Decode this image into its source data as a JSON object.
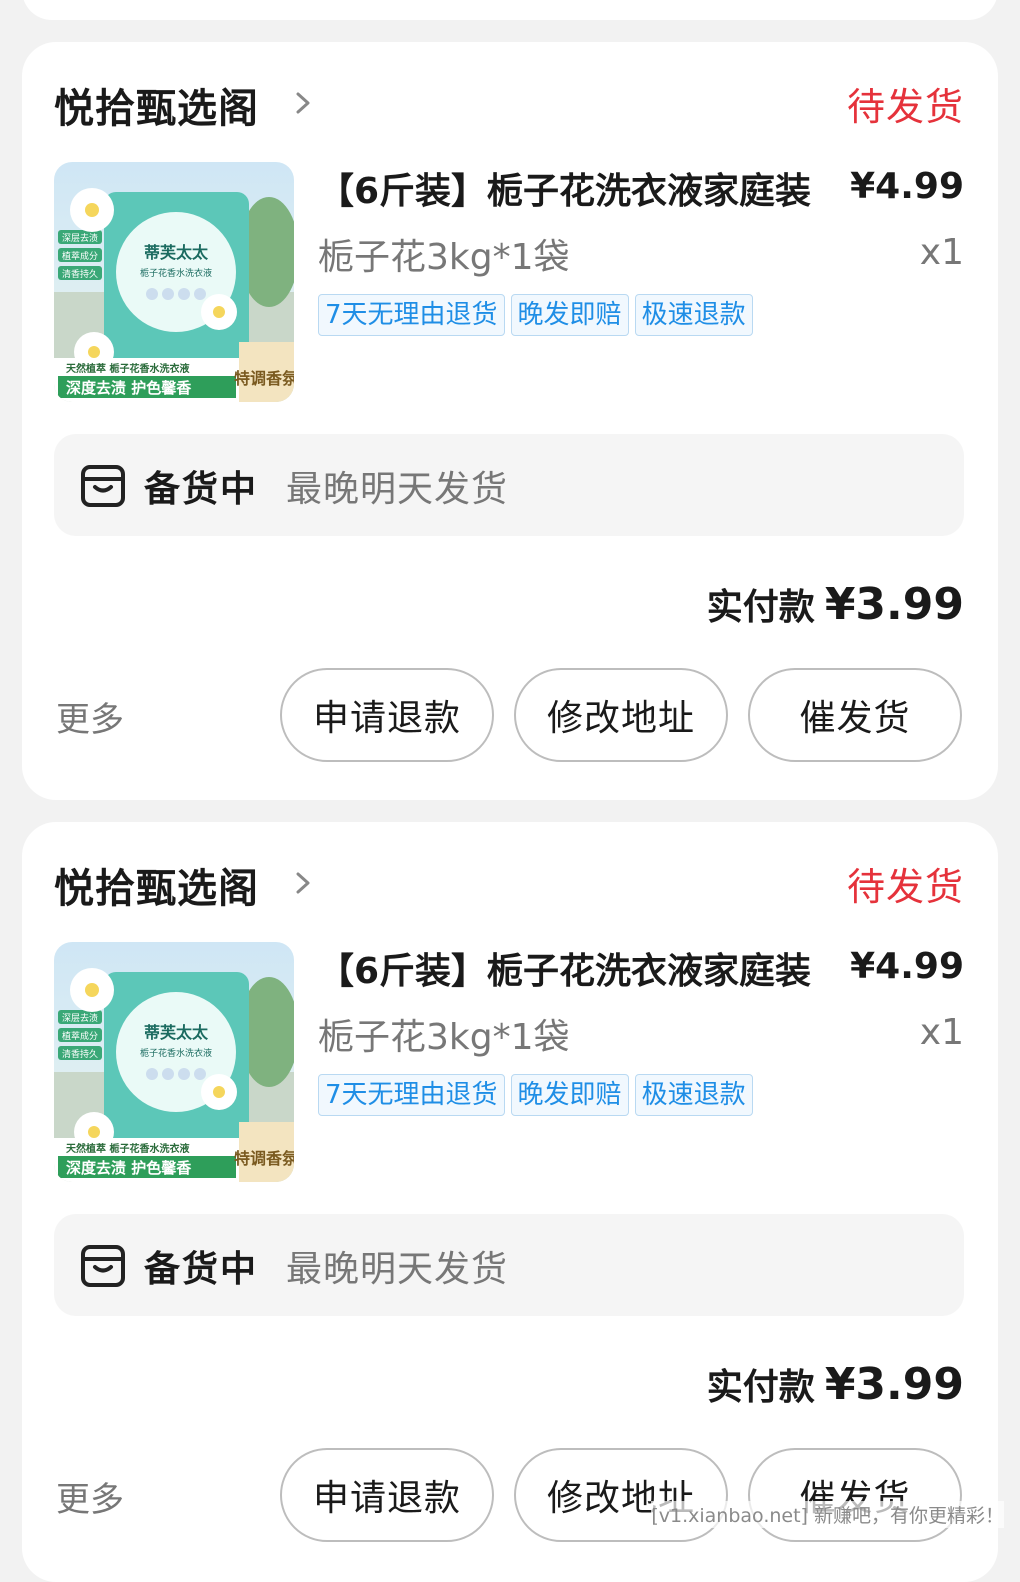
{
  "orders": [
    {
      "shop_name": "悦拾甄选阁",
      "status": "待发货",
      "product_title": "【6斤装】栀子花洗衣液家庭装",
      "price": "¥4.99",
      "spec": "栀子花3kg*1袋",
      "qty": "x1",
      "tags": [
        "7天无理由退货",
        "晚发即赔",
        "极速退款"
      ],
      "image_text": {
        "brand": "蒂芙太太",
        "sub": "栀子花香水洗衣液",
        "side": [
          "深层去渍",
          "植萃成分",
          "清香持久"
        ],
        "footer_small": "天然植萃 栀子花香水洗衣液",
        "footer_big": "深度去渍 护色馨香",
        "badge": "特调香氛"
      },
      "ship_state": "备货中",
      "ship_note": "最晚明天发货",
      "pay_label": "实付款",
      "pay_amount": "¥3.99",
      "more": "更多",
      "buttons": {
        "refund": "申请退款",
        "address": "修改地址",
        "urge": "催发货"
      }
    },
    {
      "shop_name": "悦拾甄选阁",
      "status": "待发货",
      "product_title": "【6斤装】栀子花洗衣液家庭装",
      "price": "¥4.99",
      "spec": "栀子花3kg*1袋",
      "qty": "x1",
      "tags": [
        "7天无理由退货",
        "晚发即赔",
        "极速退款"
      ],
      "image_text": {
        "brand": "蒂芙太太",
        "sub": "栀子花香水洗衣液",
        "side": [
          "深层去渍",
          "植萃成分",
          "清香持久"
        ],
        "footer_small": "天然植萃 栀子花香水洗衣液",
        "footer_big": "深度去渍 护色馨香",
        "badge": "特调香氛"
      },
      "ship_state": "备货中",
      "ship_note": "最晚明天发货",
      "pay_label": "实付款",
      "pay_amount": "¥3.99",
      "more": "更多",
      "buttons": {
        "refund": "申请退款",
        "address": "修改地址",
        "urge": "催发货"
      }
    }
  ],
  "watermark": "[v1.xianbao.net] 新赚吧，有你更精彩！",
  "colors": {
    "status_red": "#e5323b",
    "tag_blue": "#1f8ee6",
    "background": "#f2f2f2"
  }
}
